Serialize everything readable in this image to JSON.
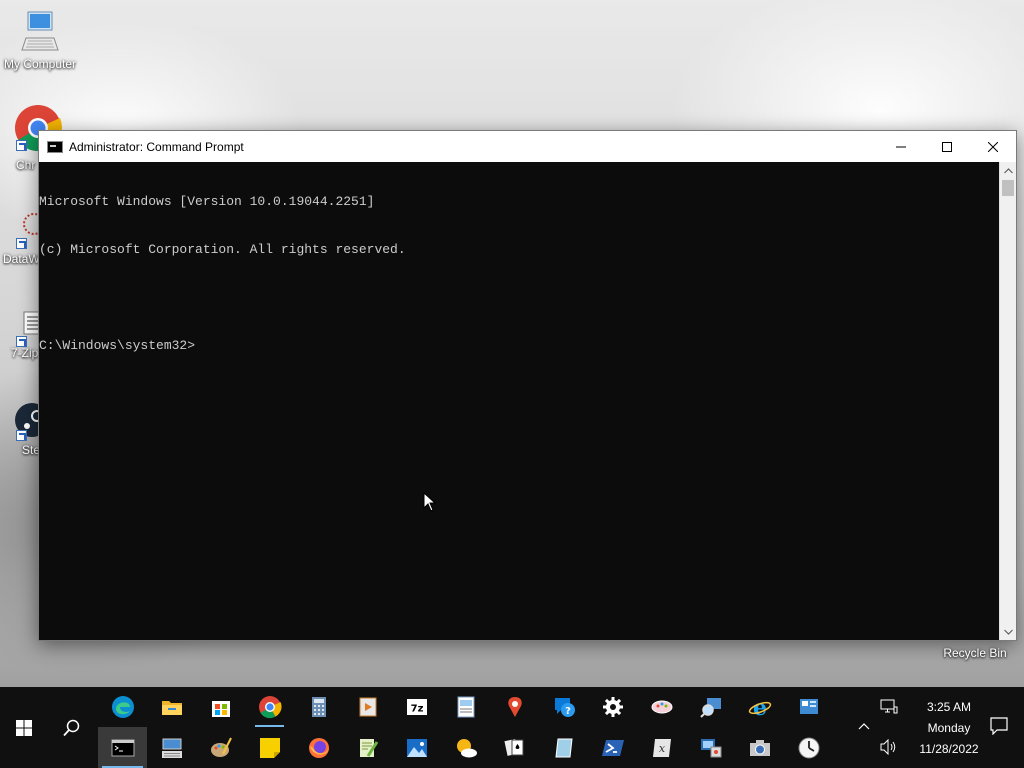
{
  "desktop": {
    "icons": [
      {
        "label": "My Computer"
      },
      {
        "label": "Chr"
      },
      {
        "label": "DataW"
      },
      {
        "label": "7-Zip"
      },
      {
        "label": "Ste"
      }
    ],
    "recycle_bin_label": "Recycle Bin"
  },
  "window": {
    "title": "Administrator: Command Prompt",
    "console_lines": [
      "Microsoft Windows [Version 10.0.19044.2251]",
      "(c) Microsoft Corporation. All rights reserved.",
      "",
      "C:\\Windows\\system32>"
    ]
  },
  "taskbar": {
    "apps_row1": [
      "edge-icon",
      "file-explorer-icon",
      "store-icon",
      "chrome-icon",
      "calculator-icon",
      "media-player-icon",
      "7zip-icon",
      "wordpad-icon",
      "maps-icon",
      "get-help-icon",
      "settings-icon",
      "paint3d-icon",
      "magnifier-icon",
      "internet-explorer-icon",
      "control-panel-icon"
    ],
    "apps_row2": [
      "command-prompt-icon",
      "keyboard-icon",
      "paint-icon",
      "sticky-notes-icon",
      "firefox-icon",
      "notepadpp-icon",
      "photos-icon",
      "weather-icon",
      "solitaire-icon",
      "mixed-reality-icon",
      "powershell-icon",
      "math-input-icon",
      "network-computer-icon",
      "camera-icon",
      "clock-icon"
    ],
    "clock": {
      "time": "3:25 AM",
      "day": "Monday",
      "date": "11/28/2022"
    }
  },
  "colors": {
    "console_bg": "#0c0c0c",
    "console_fg": "#cccccc",
    "taskbar_bg": "#101010",
    "accent": "#76b9ed"
  }
}
